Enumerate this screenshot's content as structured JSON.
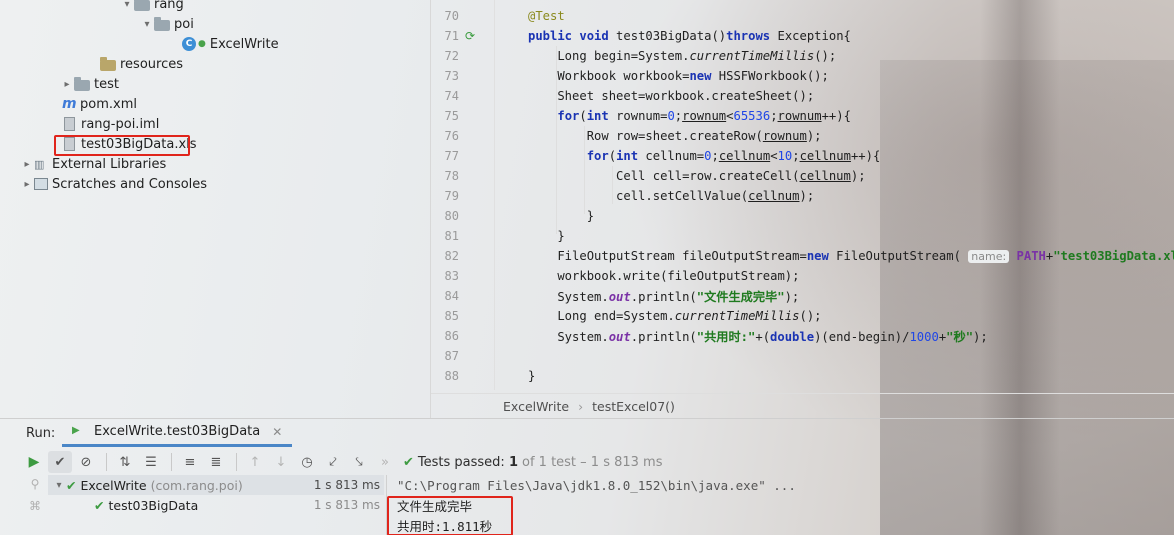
{
  "project_tree": {
    "items": [
      {
        "label": "rang"
      },
      {
        "label": "poi"
      },
      {
        "label": "ExcelWrite"
      },
      {
        "label": "resources"
      },
      {
        "label": "test"
      },
      {
        "label": "pom.xml"
      },
      {
        "label": "rang-poi.iml"
      },
      {
        "label": "test03BigData.xls"
      },
      {
        "label": "External Libraries"
      },
      {
        "label": "Scratches and Consoles"
      }
    ]
  },
  "editor": {
    "line_numbers": [
      "70",
      "71",
      "72",
      "73",
      "74",
      "75",
      "76",
      "77",
      "78",
      "79",
      "80",
      "81",
      "82",
      "83",
      "84",
      "85",
      "86",
      "87",
      "88"
    ],
    "param_hint": "name:",
    "breadcrumb": [
      "ExcelWrite",
      "testExcel07()"
    ]
  },
  "run_panel": {
    "label": "Run:",
    "tab_label": "ExcelWrite.test03BigData",
    "status_prefix": "Tests passed:",
    "status_count": "1",
    "status_detail": "of 1 test – 1 s 813 ms",
    "results": [
      {
        "name": "ExcelWrite",
        "package": "(com.rang.poi)",
        "time": "1 s 813 ms"
      },
      {
        "name": "test03BigData",
        "time": "1 s 813 ms"
      }
    ],
    "console": [
      "\"C:\\Program Files\\Java\\jdk1.8.0_152\\bin\\java.exe\" ...",
      "文件生成完毕",
      "共用时:1.811秒"
    ]
  },
  "colors": {
    "keyword": "#1a33b3",
    "string": "#1f7a1f",
    "highlight_box": "#e0241b",
    "pass_green": "#3d9b41"
  }
}
